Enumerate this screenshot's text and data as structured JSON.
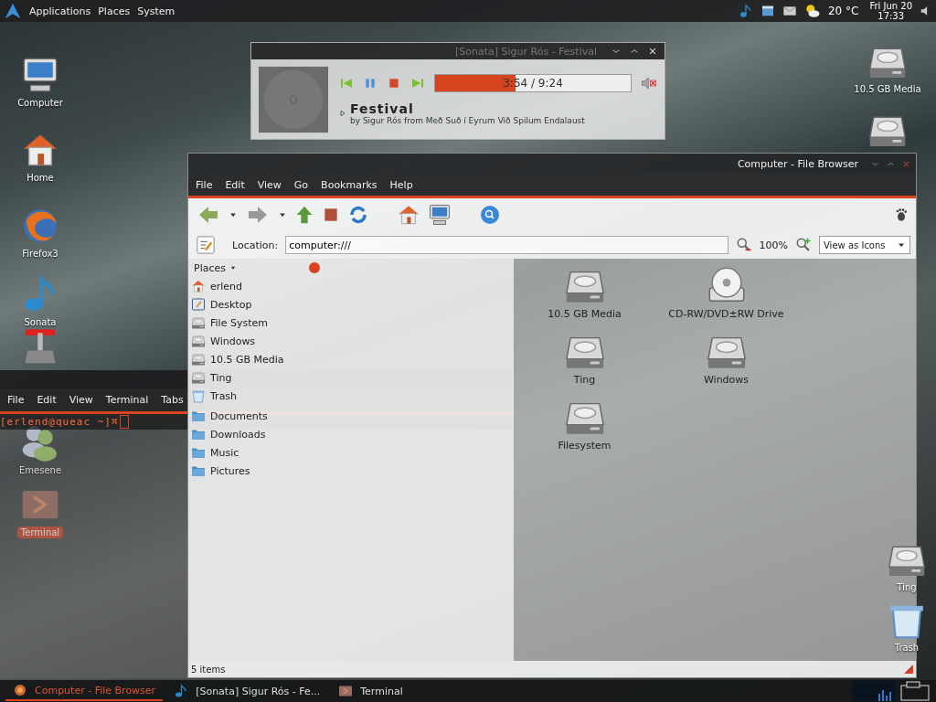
{
  "top_panel": {
    "menus": [
      "Applications",
      "Places",
      "System"
    ],
    "weather": "20 °C",
    "clock": [
      "Fri Jun 20",
      "17:33"
    ]
  },
  "desktop_icons": [
    {
      "label": "Computer",
      "kind": "computer",
      "selected": false
    },
    {
      "label": "Home",
      "kind": "home",
      "selected": false
    },
    {
      "label": "Firefox3",
      "kind": "browser",
      "selected": false
    },
    {
      "label": "Sonata",
      "kind": "music",
      "selected": false
    },
    {
      "kind": "joystick",
      "selected": false
    },
    {
      "label": "Emesene",
      "kind": "chat",
      "selected": false
    },
    {
      "label": "Terminal",
      "kind": "terminal",
      "selected": true
    },
    {
      "label": "10.5 GB Media",
      "kind": "drive",
      "selected": false
    },
    {
      "kind": "drive",
      "selected": false
    },
    {
      "label": "Ting",
      "kind": "drive",
      "selected": false
    },
    {
      "label": "Trash",
      "kind": "trash",
      "selected": false
    }
  ],
  "player": {
    "title": "[Sonata] Sigur Rós - Festival",
    "time": "3:54 / 9:24",
    "level": 0.41,
    "muted": true,
    "song": "Festival",
    "info": "by Sigur Rós from Með Suð í Eyrum Við Spilum Endalaust"
  },
  "terminal": {
    "menus": [
      "File",
      "Edit",
      "View",
      "Terminal",
      "Tabs"
    ],
    "prompt": "[erlend@queac ~]⌘"
  },
  "file_browser": {
    "title": "Computer - File Browser",
    "menus": [
      "File",
      "Edit",
      "View",
      "Go",
      "Bookmarks",
      "Help"
    ],
    "location_label": "Location:",
    "location": "computer:///",
    "zoom": "100%",
    "view_mode": "View as Icons",
    "places_header": "Places",
    "places": [
      [
        {
          "label": "erlend",
          "kind": "home"
        },
        {
          "label": "Desktop",
          "kind": "desktop"
        },
        {
          "label": "File System",
          "kind": "drive"
        },
        {
          "label": "Windows",
          "kind": "drive"
        },
        {
          "label": "10.5 GB Media",
          "kind": "drive"
        },
        {
          "label": "Ting",
          "kind": "drive"
        },
        {
          "label": "Trash",
          "kind": "trash"
        }
      ],
      [
        {
          "label": "Documents",
          "kind": "folder"
        },
        {
          "label": "Downloads",
          "kind": "folder"
        },
        {
          "label": "Music",
          "kind": "folder"
        },
        {
          "label": "Pictures",
          "kind": "folder"
        }
      ]
    ],
    "items": [
      {
        "label": "10.5 GB Media",
        "kind": "drive"
      },
      {
        "label": "CD-RW/DVD±RW Drive",
        "kind": "optical"
      },
      {
        "label": "Ting",
        "kind": "drive"
      },
      {
        "label": "Windows",
        "kind": "drive"
      },
      {
        "label": "Filesystem",
        "kind": "drive"
      }
    ],
    "status": "5 items"
  },
  "taskbar": [
    {
      "label": "Computer - File Browser",
      "kind": "file-browser",
      "selected": true
    },
    {
      "label": "[Sonata] Sigur Rós - Fe...",
      "kind": "music",
      "selected": false
    },
    {
      "label": "Terminal",
      "kind": "terminal",
      "selected": false
    }
  ]
}
